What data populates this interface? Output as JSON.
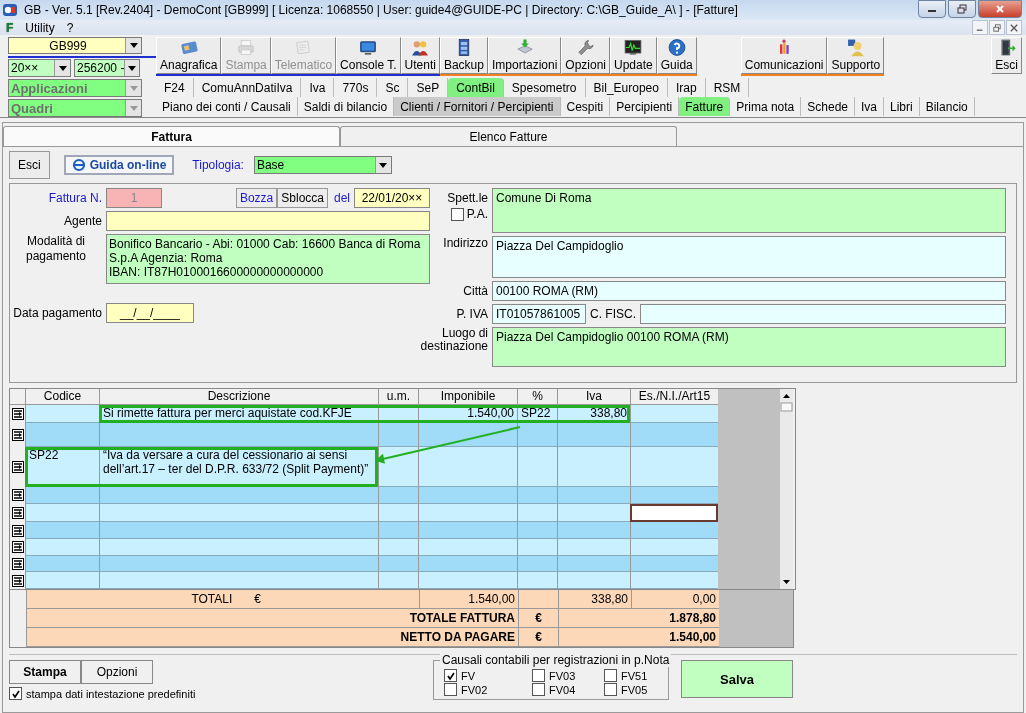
{
  "window": {
    "title": "GB - Ver. 5.1 [Rev.2404] -  DemoCont [GB999]    [ Licenza: 1068550 | User: guide4@GUIDE-PC | Directory: C:\\GB_Guide_A\\ ] - [Fatture]"
  },
  "menu": {
    "icon_char": "F",
    "items": [
      "Utility",
      "?"
    ]
  },
  "selectors": {
    "company": "GB999",
    "year": "20××",
    "code": "256200 -",
    "applications": "Applicazioni",
    "panels": "Quadri"
  },
  "toolbar": {
    "groups": [
      {
        "color": "#2030d0",
        "buttons": [
          {
            "label": "Anagrafica",
            "disabled": false
          },
          {
            "label": "Stampa",
            "disabled": true
          },
          {
            "label": "Telematico",
            "disabled": true
          },
          {
            "label": "Console T.",
            "disabled": false
          },
          {
            "label": "Utenti",
            "disabled": false
          }
        ]
      },
      {
        "color": "#f08020",
        "buttons": [
          {
            "label": "Backup",
            "disabled": false
          },
          {
            "label": "Importazioni",
            "disabled": false
          },
          {
            "label": "Opzioni",
            "disabled": false
          },
          {
            "label": "Update",
            "disabled": false
          },
          {
            "label": "Guida",
            "disabled": false
          }
        ]
      },
      {
        "color": "#f08020",
        "buttons": [
          {
            "label": "Comunicazioni",
            "disabled": false
          },
          {
            "label": "Supporto",
            "disabled": false
          }
        ]
      }
    ],
    "exit": "Esci"
  },
  "modules": [
    {
      "label": "F24",
      "selected": false
    },
    {
      "label": "ComuAnnDatiIva",
      "selected": false
    },
    {
      "label": "Iva",
      "selected": false
    },
    {
      "label": "770s",
      "selected": false
    },
    {
      "label": "Sc",
      "selected": false
    },
    {
      "label": "SeP",
      "selected": false
    },
    {
      "label": "ContBil",
      "selected": true
    },
    {
      "label": "Spesometro",
      "selected": false
    },
    {
      "label": "Bil_Europeo",
      "selected": false
    },
    {
      "label": "Irap",
      "selected": false
    },
    {
      "label": "RSM",
      "selected": false
    }
  ],
  "sections": [
    {
      "label": "Piano dei conti / Causali",
      "selected": false,
      "pressed": false
    },
    {
      "label": "Saldi di bilancio",
      "selected": false,
      "pressed": false
    },
    {
      "label": "Clienti / Fornitori / Percipienti",
      "selected": false,
      "pressed": true
    },
    {
      "label": "Cespiti",
      "selected": false,
      "pressed": false
    },
    {
      "label": "Percipienti",
      "selected": false,
      "pressed": false
    },
    {
      "label": "Fatture",
      "selected": true,
      "pressed": false
    },
    {
      "label": "Prima nota",
      "selected": false,
      "pressed": false
    },
    {
      "label": "Schede",
      "selected": false,
      "pressed": false
    },
    {
      "label": "Iva",
      "selected": false,
      "pressed": false
    },
    {
      "label": "Libri",
      "selected": false,
      "pressed": false
    },
    {
      "label": "Bilancio",
      "selected": false,
      "pressed": false
    }
  ],
  "doc_tabs": [
    {
      "label": "Fattura",
      "selected": true
    },
    {
      "label": "Elenco Fatture",
      "selected": false
    }
  ],
  "actions": {
    "exit": "Esci",
    "help": "Guida on-line",
    "type_label": "Tipologia:",
    "type_value": "Base"
  },
  "invoice": {
    "number_label": "Fattura N.",
    "number": "1",
    "draft_button": "Bozza",
    "unlock_button": "Sblocca",
    "date_label": "del",
    "date": "22/01/20××",
    "agent_label": "Agente",
    "payment_label": "Modalità di pagamento",
    "payment": [
      "Bonifico Bancario - Abi: 01000 Cab: 16600 Banca di Roma",
      "S.p.A Agenzia: Roma",
      "IBAN: IT87H0100016600000000000000"
    ],
    "payment_date_label": "Data pagamento",
    "payment_date": "__/__/____"
  },
  "customer": {
    "label": "Spett.le",
    "name": "Comune Di Roma",
    "pa_label": "P.A.",
    "pa_checked": false,
    "address_label": "Indirizzo",
    "address": "Piazza Del Campidoglio",
    "city_label": "Città",
    "city": "00100  ROMA (RM)",
    "vat_label": "P. IVA",
    "vat": "IT01057861005",
    "tax_code_label": "C. FISC.",
    "destination_label": "Luogo di destinazione",
    "destination": "Piazza Del Campidoglio  00100  ROMA (RM)"
  },
  "table": {
    "columns": [
      "Codice",
      "Descrizione",
      "u.m.",
      "Imponibile",
      "%",
      "Iva",
      "Es./N.I./Art15"
    ],
    "rows": [
      {
        "cells": {
          "descrizione": "Si rimette fattura per merci aquistate cod.KFJE",
          "imponibile": "1.540,00",
          "percentuale": "SP22",
          "iva": "338,80"
        },
        "selected": false
      },
      {
        "cells": {},
        "selected": false
      },
      {
        "cells": {
          "codice": "SP22",
          "descrizione": "“Iva da versare a cura del cessionario ai sensi dell’art.17 – ter del D.P.R. 633/72 (Split Payment)”"
        },
        "selected": false
      },
      {
        "cells": {},
        "selected": false
      },
      {
        "cells": {},
        "selected": true
      },
      {
        "cells": {},
        "selected": false
      },
      {
        "cells": {},
        "selected": false
      },
      {
        "cells": {},
        "selected": false
      },
      {
        "cells": {},
        "selected": false
      }
    ]
  },
  "totals": {
    "label": "TOTALI",
    "currency": "€",
    "imponibile": "1.540,00",
    "iva": "338,80",
    "esente": "0,00",
    "summary": [
      {
        "label": "TOTALE FATTURA",
        "currency": "€",
        "value": "1.878,80"
      },
      {
        "label": "NETTO DA PAGARE",
        "currency": "€",
        "value": "1.540,00"
      }
    ]
  },
  "footer": {
    "print": "Stampa",
    "options": "Opzioni",
    "default_header": {
      "label": "stampa dati intestazione predefiniti",
      "checked": true
    },
    "causali": {
      "title": "Causali contabili per registrazioni in p.Nota",
      "items": [
        {
          "label": "FV",
          "checked": true
        },
        {
          "label": "FV03",
          "checked": false
        },
        {
          "label": "FV51",
          "checked": false
        },
        {
          "label": "FV02",
          "checked": false
        },
        {
          "label": "FV04",
          "checked": false
        },
        {
          "label": "FV05",
          "checked": false
        }
      ]
    },
    "save": "Salva"
  }
}
